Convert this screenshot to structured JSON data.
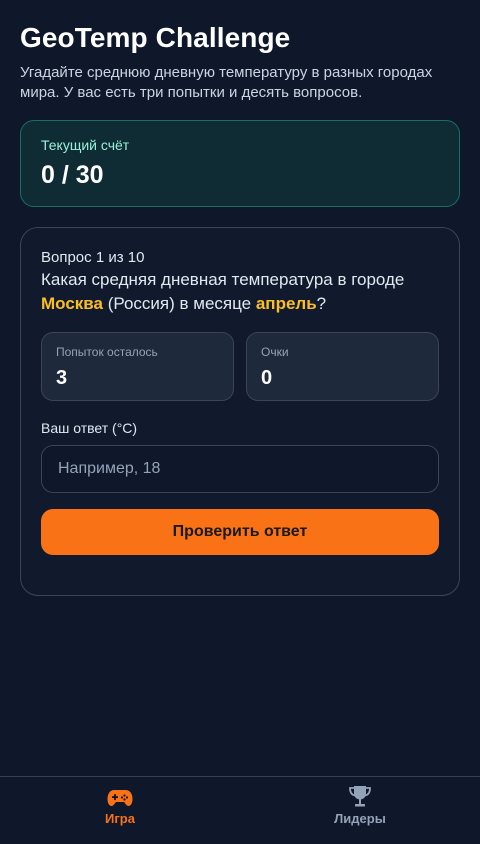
{
  "header": {
    "title": "GeoTemp Challenge",
    "subtitle": "Угадайте среднюю дневную температуру в разных городах мира. У вас есть три попытки и десять вопросов."
  },
  "score": {
    "label": "Текущий счёт",
    "value": "0 / 30"
  },
  "question": {
    "counter": "Вопрос 1 из 10",
    "text_prefix": "Какая средняя дневная температура в городе",
    "city": "Москва",
    "country": "(Россия) в месяце",
    "month": "апрель",
    "suffix": "?"
  },
  "stats": {
    "attempts_label": "Попыток осталось",
    "attempts_value": "3",
    "points_label": "Очки",
    "points_value": "0"
  },
  "answer": {
    "label": "Ваш ответ (°C)",
    "placeholder": "Например, 18",
    "value": ""
  },
  "buttons": {
    "check_label": "Проверить ответ"
  },
  "nav": {
    "items": [
      {
        "label": "Игра",
        "icon": "gamepad-icon",
        "active": true
      },
      {
        "label": "Лидеры",
        "icon": "trophy-icon",
        "active": false
      }
    ]
  },
  "colors": {
    "accent": "#f97316",
    "highlight": "#fbbf24",
    "background": "#0f172a"
  }
}
